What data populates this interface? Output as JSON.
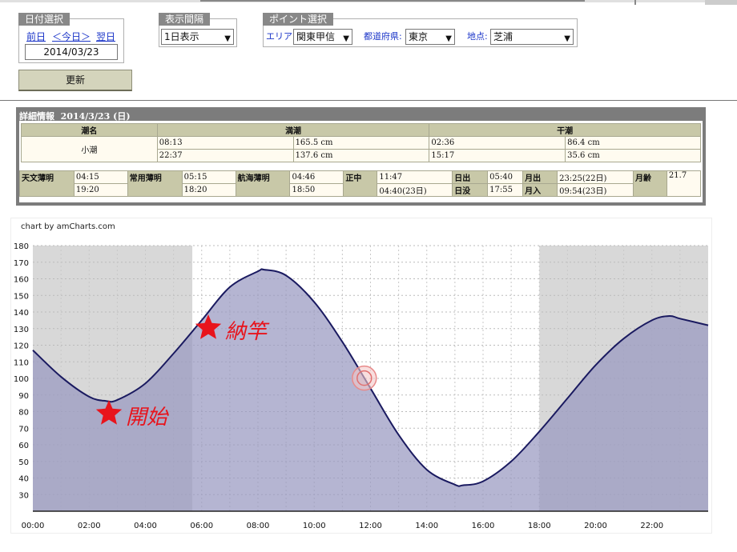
{
  "date_panel": {
    "title": "日付選択",
    "prev": "前日",
    "today": "＜今日＞",
    "next": "翌日",
    "date_value": "2014/03/23",
    "update_button": "更新"
  },
  "interval_panel": {
    "title": "表示間隔",
    "selected": "1日表示"
  },
  "point_panel": {
    "title": "ポイント選択",
    "area_label": "エリア:",
    "area_value": "関東甲信",
    "pref_label": "都道府県:",
    "pref_value": "東京",
    "place_label": "地点:",
    "place_value": "芝浦"
  },
  "detail": {
    "title": "詳細情報",
    "date": "2014/3/23 (日)",
    "tide_table": {
      "headers": [
        "潮名",
        "満潮",
        "干潮"
      ],
      "tide_name": "小潮",
      "high": [
        [
          "08:13",
          "165.5 cm"
        ],
        [
          "22:37",
          "137.6 cm"
        ]
      ],
      "low": [
        [
          "02:36",
          "86.4 cm"
        ],
        [
          "15:17",
          "35.6 cm"
        ]
      ]
    },
    "sun_table": {
      "astro_twilight_label": "天文薄明",
      "astro_twilight": [
        "04:15",
        "19:20"
      ],
      "civil_twilight_label": "常用薄明",
      "civil_twilight": [
        "05:15",
        "18:20"
      ],
      "nautical_twilight_label": "航海薄明",
      "nautical_twilight": [
        "04:46",
        "18:50"
      ],
      "noon_label": "正中",
      "noon": [
        "11:47",
        "04:40(23日)"
      ],
      "sunrise_label": "日出",
      "sunrise": "05:40",
      "sunset_label": "日没",
      "sunset": "17:55",
      "moonrise_label": "月出",
      "moonrise": "23:25(22日)",
      "moonset_label": "月入",
      "moonset": "09:54(23日)",
      "moon_age_label": "月齢",
      "moon_age": "21.7"
    }
  },
  "chart_credit": "chart by amCharts.com",
  "annotations": {
    "start": "開始",
    "end": "納竿"
  },
  "colors": {
    "night_shade": "#d8d8d8",
    "area_fill": "#9898c0",
    "line": "#1a1a60",
    "star": "#e8141c",
    "header_gray": "#888888"
  },
  "chart_data": {
    "type": "area",
    "x_ticks": [
      "00:00",
      "02:00",
      "04:00",
      "06:00",
      "08:00",
      "10:00",
      "12:00",
      "14:00",
      "16:00",
      "18:00",
      "20:00",
      "22:00"
    ],
    "y_ticks": [
      180,
      170,
      160,
      150,
      140,
      130,
      120,
      110,
      100,
      90,
      80,
      70,
      60,
      50,
      40,
      30
    ],
    "xlim": [
      0,
      24
    ],
    "ylim": [
      20,
      180
    ],
    "series": [
      {
        "x": [
          0,
          1,
          2,
          2.6,
          3,
          4,
          5,
          6,
          7,
          8,
          8.22,
          9,
          10,
          11,
          12,
          13,
          14,
          15,
          15.28,
          16,
          17,
          18,
          19,
          20,
          21,
          22,
          22.62,
          23,
          24
        ],
        "values": [
          117,
          101,
          89,
          86.4,
          87,
          97,
          115,
          135,
          155,
          164.5,
          165.5,
          162,
          146,
          122,
          94,
          66,
          45,
          36,
          35.6,
          38,
          50,
          68,
          88,
          108,
          124,
          135,
          137.6,
          136,
          132
        ]
      }
    ],
    "night_shading": [
      [
        0,
        5.667
      ],
      [
        18,
        24
      ]
    ],
    "marker_x": 11.78,
    "grid": true
  }
}
